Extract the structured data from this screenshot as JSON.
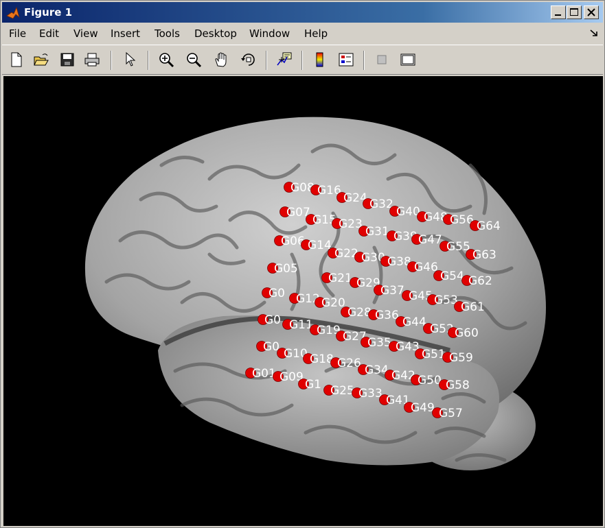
{
  "window": {
    "title": "Figure 1"
  },
  "menu": [
    {
      "label": "File"
    },
    {
      "label": "Edit"
    },
    {
      "label": "View"
    },
    {
      "label": "Insert"
    },
    {
      "label": "Tools"
    },
    {
      "label": "Desktop"
    },
    {
      "label": "Window"
    },
    {
      "label": "Help"
    }
  ],
  "toolbar": {
    "buttons": [
      {
        "icon": "new-figure-icon"
      },
      {
        "icon": "open-file-icon"
      },
      {
        "icon": "save-icon"
      },
      {
        "icon": "print-icon"
      },
      {
        "icon": "edit-plot-arrow-icon"
      },
      {
        "icon": "zoom-in-icon"
      },
      {
        "icon": "zoom-out-icon"
      },
      {
        "icon": "pan-hand-icon"
      },
      {
        "icon": "rotate-3d-icon"
      },
      {
        "icon": "data-cursor-icon"
      },
      {
        "icon": "insert-colorbar-icon"
      },
      {
        "icon": "insert-legend-icon"
      },
      {
        "icon": "hide-plot-tools-icon"
      },
      {
        "icon": "show-plot-tools-icon"
      }
    ]
  },
  "colors": {
    "electrode": "#e00000",
    "brain": "#a8a8a8",
    "background": "#000000",
    "label": "#ffffff"
  },
  "electrodes": [
    {
      "label": "G08"
    },
    {
      "label": "G16"
    },
    {
      "label": "G24"
    },
    {
      "label": "G32"
    },
    {
      "label": "G40"
    },
    {
      "label": "G48"
    },
    {
      "label": "G56"
    },
    {
      "label": "G64"
    },
    {
      "label": "G07"
    },
    {
      "label": "G15"
    },
    {
      "label": "G23"
    },
    {
      "label": "G31"
    },
    {
      "label": "G39"
    },
    {
      "label": "G47"
    },
    {
      "label": "G55"
    },
    {
      "label": "G63"
    },
    {
      "label": "G06"
    },
    {
      "label": "G14"
    },
    {
      "label": "G22"
    },
    {
      "label": "G30"
    },
    {
      "label": "G38"
    },
    {
      "label": "G46"
    },
    {
      "label": "G54"
    },
    {
      "label": "G62"
    },
    {
      "label": "G05"
    },
    {
      "label": "G21"
    },
    {
      "label": "G29"
    },
    {
      "label": "G37"
    },
    {
      "label": "G45"
    },
    {
      "label": "G53"
    },
    {
      "label": "G61"
    },
    {
      "label": "G0"
    },
    {
      "label": "G12"
    },
    {
      "label": "G20"
    },
    {
      "label": "G28"
    },
    {
      "label": "G36"
    },
    {
      "label": "G44"
    },
    {
      "label": "G52"
    },
    {
      "label": "G60"
    },
    {
      "label": "G0"
    },
    {
      "label": "G11"
    },
    {
      "label": "G19"
    },
    {
      "label": "G27"
    },
    {
      "label": "G35"
    },
    {
      "label": "G43"
    },
    {
      "label": "G51"
    },
    {
      "label": "G59"
    },
    {
      "label": "G0"
    },
    {
      "label": "G10"
    },
    {
      "label": "G18"
    },
    {
      "label": "G26"
    },
    {
      "label": "G34"
    },
    {
      "label": "G42"
    },
    {
      "label": "G50"
    },
    {
      "label": "G58"
    },
    {
      "label": "G01"
    },
    {
      "label": "G09"
    },
    {
      "label": "G1"
    },
    {
      "label": "G25"
    },
    {
      "label": "G33"
    },
    {
      "label": "G41"
    },
    {
      "label": "G49"
    },
    {
      "label": "G57"
    }
  ]
}
